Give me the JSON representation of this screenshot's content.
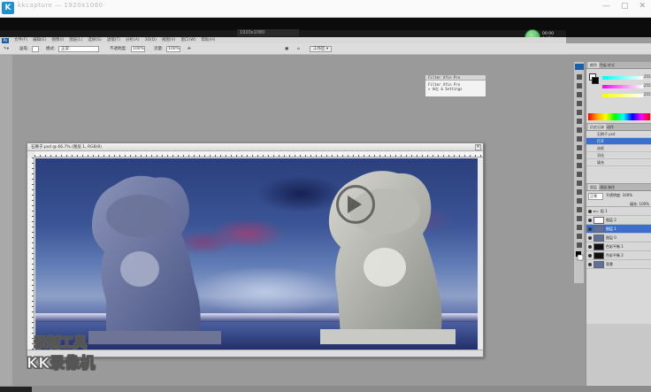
{
  "outer_app": {
    "title": "kkcapture — 1920x1080",
    "controls": [
      "—",
      "▢",
      "✕"
    ]
  },
  "recorder": {
    "resolution": "1920x1080",
    "stats_line1": "00:00",
    "stats_line2": "0 KB/s"
  },
  "menu": {
    "items": [
      "文件(F)",
      "编辑(E)",
      "图像(I)",
      "图层(L)",
      "选择(S)",
      "滤镜(T)",
      "分析(A)",
      "3D(D)",
      "视图(V)",
      "窗口(W)",
      "帮助(H)"
    ]
  },
  "options": {
    "brush_label": "画笔:",
    "mode_label": "模式:",
    "mode_value": "正常",
    "opacity_label": "不透明度:",
    "opacity_value": "100%",
    "flow_label": "流量:",
    "flow_value": "100%",
    "workspace": "工作区 ▾"
  },
  "document": {
    "title": "石狮子.psd @ 66.7% (图层 1, RGB/8)",
    "close": "×"
  },
  "float_panel": {
    "header": "Filter Xfin Pro",
    "line1": "Filter Xfin Pro",
    "line2": "» Adj & Settings"
  },
  "dock": {
    "color_tabs": [
      "颜色",
      "色板",
      "样式"
    ],
    "history_tabs": [
      "历史记录",
      "动作"
    ],
    "history_items": [
      "石狮子.psd",
      "打开",
      "选框",
      "羽化",
      "填充"
    ],
    "layers_tabs": [
      "图层",
      "通道",
      "路径"
    ],
    "blend_mode": "正常",
    "opacity_label": "不透明度: 100%",
    "fill_label": "填充: 100%",
    "layers": [
      {
        "name": "组 1",
        "thumb": "none",
        "selected": false
      },
      {
        "name": "图层 2",
        "thumb": "white",
        "selected": false
      },
      {
        "name": "图层 1",
        "thumb": "photo",
        "selected": true
      },
      {
        "name": "图层 0",
        "thumb": "photo",
        "selected": false
      },
      {
        "name": "色彩平衡 1",
        "thumb": "dark",
        "selected": false
      },
      {
        "name": "色彩平衡 2",
        "thumb": "dark",
        "selected": false
      },
      {
        "name": "背景",
        "thumb": "photo",
        "selected": false
      }
    ],
    "color_values": [
      "255",
      "255",
      "255"
    ]
  },
  "watermark": {
    "line1": "录制工具",
    "line2": "KK录像机"
  },
  "colors": {
    "sky_top": "#2b3f7c",
    "selection_blue": "#3a6fd0",
    "badge_green": "#2da23a"
  }
}
